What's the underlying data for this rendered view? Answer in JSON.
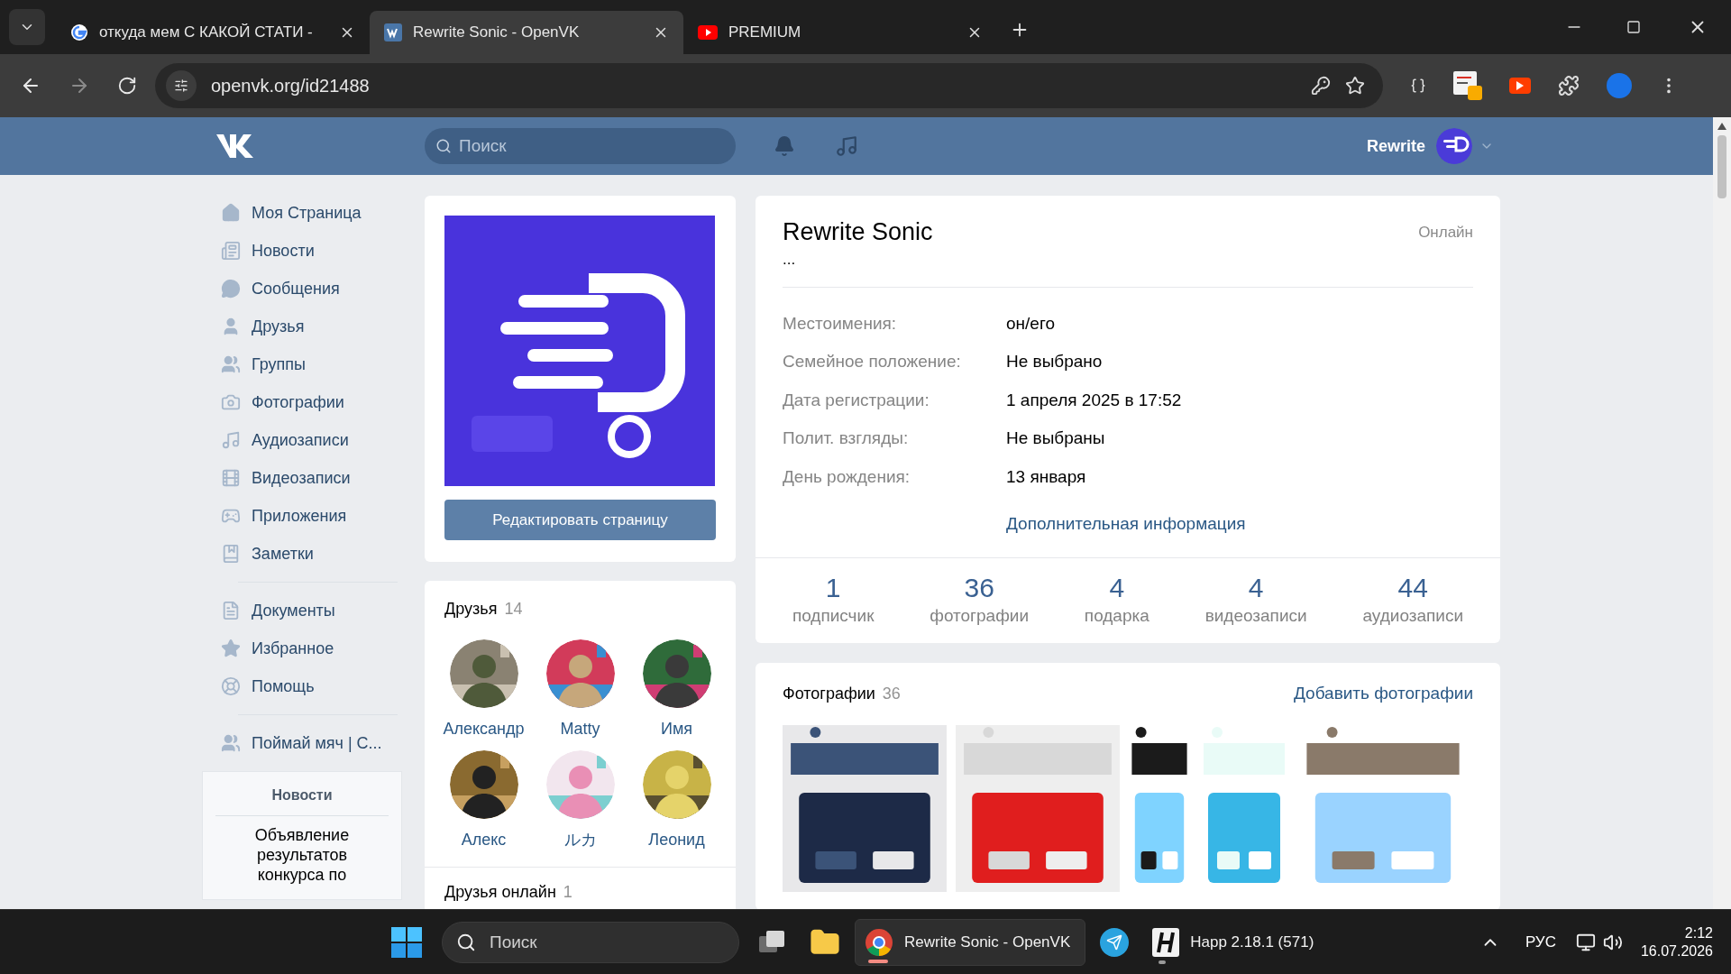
{
  "browser": {
    "tabs": [
      {
        "title": "откуда мем С КАКОЙ СТАТИ -",
        "kind": "google",
        "selected": false
      },
      {
        "title": "Rewrite Sonic - OpenVK",
        "kind": "vk",
        "selected": true
      },
      {
        "title": "PREMIUM",
        "kind": "youtube",
        "selected": false
      }
    ],
    "url": "openvk.org/id21488"
  },
  "header": {
    "search_placeholder": "Поиск",
    "user_name": "Rewrite"
  },
  "sidebar": {
    "groups": [
      [
        {
          "label": "Моя Страница",
          "kind": "home"
        },
        {
          "label": "Новости",
          "kind": "news"
        },
        {
          "label": "Сообщения",
          "kind": "messages"
        },
        {
          "label": "Друзья",
          "kind": "friend"
        },
        {
          "label": "Группы",
          "kind": "groups"
        },
        {
          "label": "Фотографии",
          "kind": "photos"
        },
        {
          "label": "Аудиозаписи",
          "kind": "audio"
        },
        {
          "label": "Видеозаписи",
          "kind": "video"
        },
        {
          "label": "Приложения",
          "kind": "apps"
        },
        {
          "label": "Заметки",
          "kind": "notes"
        }
      ],
      [
        {
          "label": "Документы",
          "kind": "docs"
        },
        {
          "label": "Избранное",
          "kind": "fave"
        },
        {
          "label": "Помощь",
          "kind": "help"
        }
      ],
      [
        {
          "label": "Поймай мяч | С...",
          "kind": "groups"
        }
      ]
    ],
    "news_widget": {
      "title": "Новости",
      "text": "Объявление результатов конкурса по"
    }
  },
  "avatar_card": {
    "edit_button": "Редактировать страницу"
  },
  "friends": {
    "title": "Друзья",
    "count": "14",
    "items": [
      {
        "name": "Александр"
      },
      {
        "name": "Matty"
      },
      {
        "name": "Имя"
      },
      {
        "name": "Алекс"
      },
      {
        "name": "ルカ"
      },
      {
        "name": "Леонид"
      }
    ]
  },
  "friends_online": {
    "title": "Друзья онлайн",
    "count": "1"
  },
  "profile": {
    "name": "Rewrite Sonic",
    "status": "...",
    "online": "Онлайн",
    "info": [
      {
        "label": "Местоимения:",
        "value": "он/его"
      },
      {
        "label": "Семейное положение:",
        "value": "Не выбрано"
      },
      {
        "label": "Дата регистрации:",
        "value": "1 апреля 2025 в 17:52"
      },
      {
        "label": "Полит. взгляды:",
        "value": "Не выбраны"
      },
      {
        "label": "День рождения:",
        "value": "13 января"
      }
    ],
    "more_link": "Дополнительная информация",
    "counters": [
      {
        "value": "1",
        "label": "подписчик"
      },
      {
        "value": "36",
        "label": "фотографии"
      },
      {
        "value": "4",
        "label": "подарка"
      },
      {
        "value": "4",
        "label": "видеозаписи"
      },
      {
        "value": "44",
        "label": "аудиозаписи"
      }
    ]
  },
  "photos": {
    "title": "Фотографии",
    "count": "36",
    "add_link": "Добавить фотографии"
  },
  "taskbar": {
    "search_placeholder": "Поиск",
    "apps": [
      {
        "kind": "taskview",
        "active": false,
        "running": false
      },
      {
        "kind": "files",
        "active": false,
        "running": false
      },
      {
        "kind": "chrome",
        "title": "Rewrite Sonic - OpenVK",
        "active": true,
        "running": true
      },
      {
        "kind": "telegram",
        "active": false,
        "running": false
      },
      {
        "kind": "happ",
        "title": "Happ 2.18.1 (571)",
        "active": false,
        "running": true
      }
    ],
    "language": "РУС",
    "time": "2:12",
    "date": "16.07.2026"
  }
}
